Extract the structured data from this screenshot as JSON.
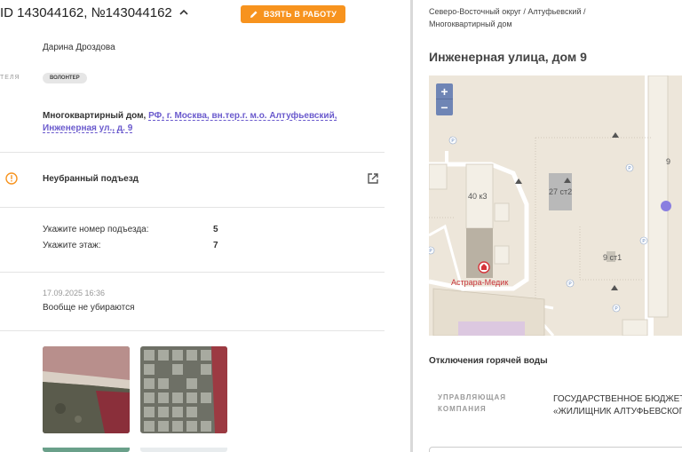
{
  "header": {
    "id_text": "ID 143044162, №143044162",
    "take_button": "ВЗЯТЬ В РАБОТУ"
  },
  "user": {
    "name": "Дарина Дроздова",
    "role_label": "ТЕЛЯ",
    "role_badge": "ВОЛОНТЕР"
  },
  "address": {
    "type": "Многоквартирный дом,",
    "link": "РФ, г. Москва, вн.тер.г. м.о. Алтуфьевский, Инженерная ул., д. 9"
  },
  "issue": {
    "title": "Неубранный подъезд"
  },
  "details": [
    {
      "label": "Укажите номер подъезда:",
      "value": "5"
    },
    {
      "label": "Укажите этаж:",
      "value": "7"
    }
  ],
  "comment": {
    "date": "17.09.2025 16:36",
    "text": "Вообще не убираются"
  },
  "right": {
    "breadcrumb_line1": "Северо-Восточный округ / Алтуфьевский /",
    "breadcrumb_line2": "Многоквартирный дом",
    "title": "Инженерная улица, дом 9",
    "zoom_in": "+",
    "zoom_out": "−",
    "map_labels": {
      "building_a": "40 к3",
      "building_b": "27 ст2",
      "building_c": "9 ст1",
      "building_d": "9",
      "clinic": "Астрара-Медик"
    },
    "hot_water_title": "Отключения горячей воды",
    "mc_label_1": "УПРАВЛЯЮЩАЯ",
    "mc_label_2": "КОМПАНИЯ",
    "mc_value_1": "ГОСУДАРСТВЕННОЕ БЮДЖЕТНОЕ",
    "mc_value_2": "«ЖИЛИЩНИК АЛТУФЬЕВСКОГО»"
  },
  "colors": {
    "accent": "#f7931e",
    "link": "#6a5acd",
    "map_bg": "#ede6da",
    "zoom": "#6f85b5",
    "marker": "#8a7fe0",
    "warning": "#f7931e"
  },
  "icons": {
    "take": "pencil-icon",
    "collapse": "chevron-up-icon",
    "issue": "warning-circle-icon",
    "open": "external-link-icon"
  }
}
